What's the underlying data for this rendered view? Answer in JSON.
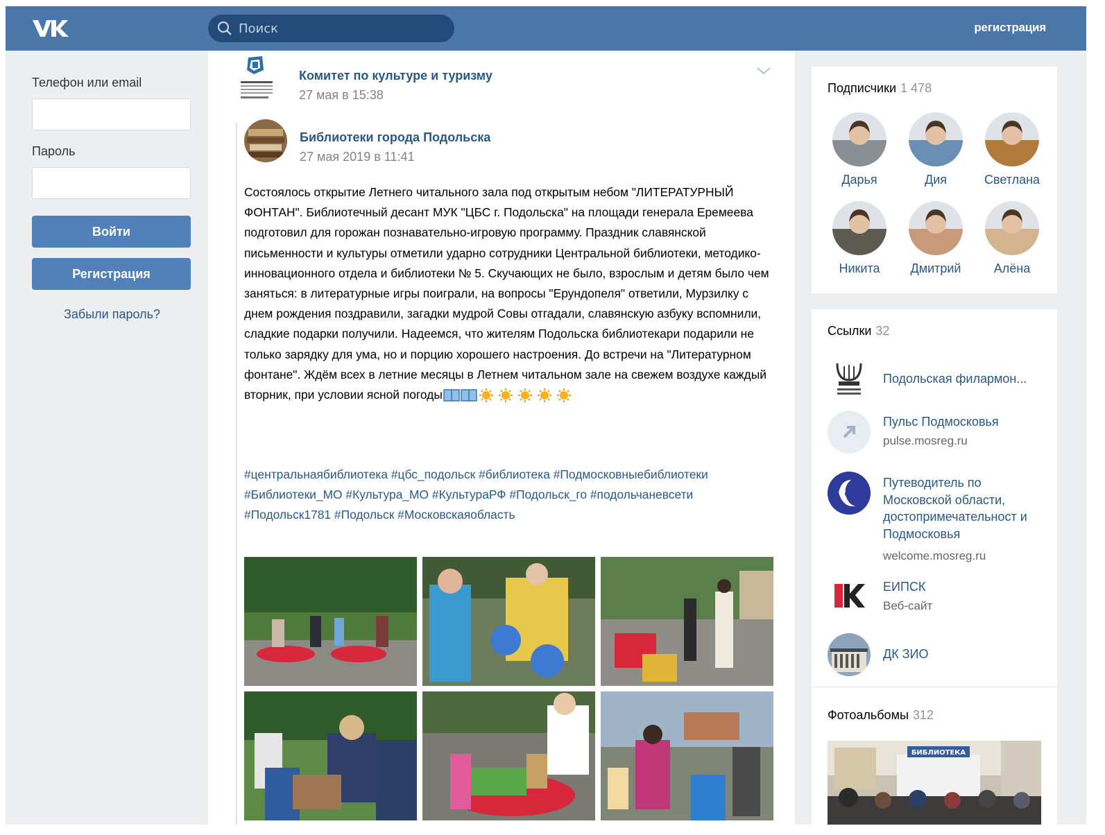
{
  "header": {
    "search_placeholder": "Поиск",
    "register_label": "регистрация"
  },
  "login": {
    "phone_label": "Телефон или email",
    "password_label": "Пароль",
    "login_button": "Войти",
    "register_button": "Регистрация",
    "forgot_link": "Забыли пароль?"
  },
  "post": {
    "author": "Комитет по культуре и туризму",
    "date": "27 мая в 15:38",
    "repost": {
      "author": "Библиотеки города Подольска",
      "date": "27 мая 2019 в 11:41",
      "text": "Состоялось открытие Летнего читального зала под открытым небом \"ЛИТЕРАТУРНЫЙ ФОНТАН\". Библиотечный десант МУК \"ЦБС г. Подольска\" на площади генерала Еремеева подготовил для горожан познавательно-игровую программу. Праздник славянской письменности и культуры отметили ударно сотрудники Центральной библиотеки, методико-инновационного отдела и библиотеки № 5. Скучающих не было, взрослым и детям было чем заняться: в литературные игры поиграли, на вопросы \"Ерундопеля\" ответили, Мурзилку с днем рождения поздравили, загадки мудрой Совы отгадали, славянскую азбуку вспомнили, сладкие подарки получили. Надеемся, что жителям Подольска библиотекари подарили не только зарядку для ума, но и порцию хорошего настроения. До встречи на \"Литературном фонтане\". Ждём всех в летние месяцы в Летнем читальном зале на свежем воздухе каждый вторник, при условии ясной погоды",
      "hashtags": "#центральнаябиблиотека #цбс_подольск #библиотека #Подмосковныебиблиотеки #Библиотеки_МО #Культура_МО #КультураРФ #Подольск_го #подольчаневсети #Подольск1781 #Подольск #Московскаяобласть"
    }
  },
  "subscribers": {
    "title": "Подписчики",
    "count": "1 478",
    "people": [
      {
        "name": "Дарья",
        "color": "#8a8f96"
      },
      {
        "name": "Дия",
        "color": "#6b8fb4"
      },
      {
        "name": "Светлана",
        "color": "#b07a3a"
      },
      {
        "name": "Никита",
        "color": "#5d5a52"
      },
      {
        "name": "Дмитрий",
        "color": "#c89a7a"
      },
      {
        "name": "Алёна",
        "color": "#d3b48c"
      }
    ]
  },
  "links": {
    "title": "Ссылки",
    "count": "32",
    "items": [
      {
        "title": "Подольская филармон...",
        "subtitle": ""
      },
      {
        "title": "Пульс Подмосковья",
        "subtitle": "pulse.mosreg.ru"
      },
      {
        "title": "Путеводитель по Московской области, достопримечательност и Подмосковья",
        "subtitle": "welcome.mosreg.ru"
      },
      {
        "title": "ЕИПСК",
        "subtitle": "Веб-сайт"
      },
      {
        "title": "ДК ЗИО",
        "subtitle": ""
      }
    ]
  },
  "albums": {
    "title": "Фотоальбомы",
    "count": "312",
    "cover_sign": "БИБЛИОТЕКА"
  },
  "colors": {
    "header": "#4a76a8",
    "link": "#2a5885",
    "button": "#5181b8",
    "background": "#edeef0"
  }
}
